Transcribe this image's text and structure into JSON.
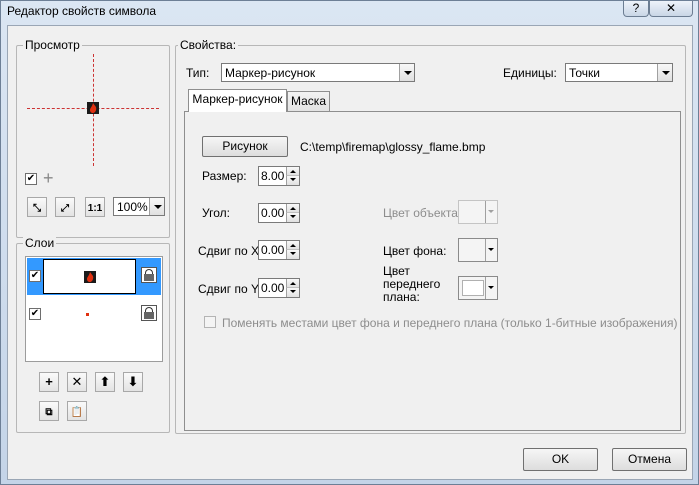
{
  "window": {
    "title": "Редактор свойств символа",
    "help_label": "?"
  },
  "preview": {
    "group_title": "Просмотр",
    "zoom_value": "100%"
  },
  "layers": {
    "group_title": "Слои"
  },
  "properties": {
    "group_title": "Свойства:",
    "type_label": "Тип:",
    "type_value": "Маркер-рисунок",
    "units_label": "Единицы:",
    "units_value": "Точки",
    "tabs": [
      {
        "label": "Маркер-рисунок"
      },
      {
        "label": "Маска"
      }
    ],
    "picture_button": "Рисунок",
    "picture_path": "C:\\temp\\firemap\\glossy_flame.bmp",
    "size_label": "Размер:",
    "size_value": "8.00",
    "angle_label": "Угол:",
    "angle_value": "0.00",
    "offset_x_label": "Сдвиг по X:",
    "offset_x_value": "0.00",
    "offset_y_label": "Сдвиг по Y:",
    "offset_y_value": "0.00",
    "object_color_label": "Цвет объекта:",
    "background_color_label": "Цвет фона:",
    "foreground_color_label": "Цвет переднего плана:",
    "swap_colors_label": "Поменять местами цвет фона и переднего плана (только 1-битные изображения)"
  },
  "footer": {
    "ok_label": "OK",
    "cancel_label": "Отмена"
  },
  "colors": {
    "selection": "#3399ff",
    "marker": "#e03010"
  }
}
